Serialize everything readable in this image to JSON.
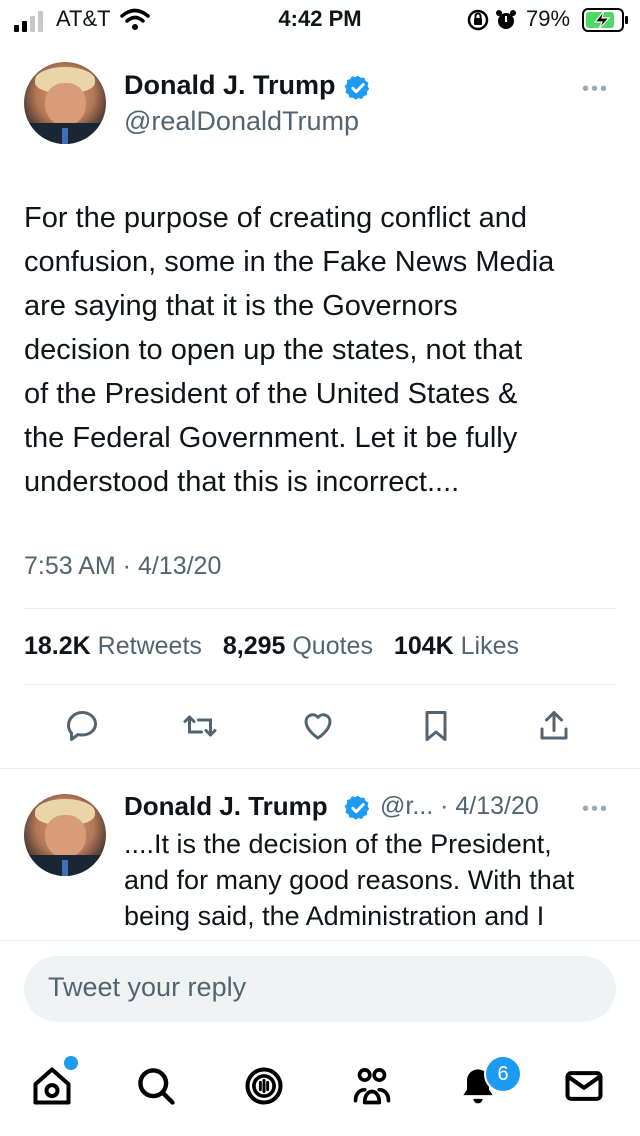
{
  "status_bar": {
    "carrier": "AT&T",
    "time": "4:42 PM",
    "battery_percent": "79%",
    "signal_bars": 2
  },
  "tweet": {
    "author_name": "Donald J. Trump",
    "author_handle": "@realDonaldTrump",
    "more": "•••",
    "text": "For the purpose of creating conflict and\nconfusion, some in the Fake News Media\nare saying that it is the Governors\ndecision to open up the states, not that\nof the President of the United States &\nthe Federal Government. Let it be fully\nunderstood that this is incorrect....",
    "timestamp": "7:53 AM · 4/13/20",
    "stats": {
      "retweets_count": "18.2K",
      "retweets_label": "Retweets",
      "quotes_count": "8,295",
      "quotes_label": "Quotes",
      "likes_count": "104K",
      "likes_label": "Likes"
    }
  },
  "reply": {
    "author_name": "Donald J. Trump",
    "author_handle": "@r... · 4/13/20",
    "more": "•••",
    "text": "....It is the decision of the President,\nand for many good reasons. With that\nbeing said, the Administration and I"
  },
  "reply_box": {
    "placeholder": "Tweet your reply"
  },
  "tab_bar": {
    "notifications_badge": "6"
  },
  "colors": {
    "accent": "#1d9bf0",
    "text": "#0f1419",
    "secondary": "#536471",
    "battery": "#4cd964"
  }
}
